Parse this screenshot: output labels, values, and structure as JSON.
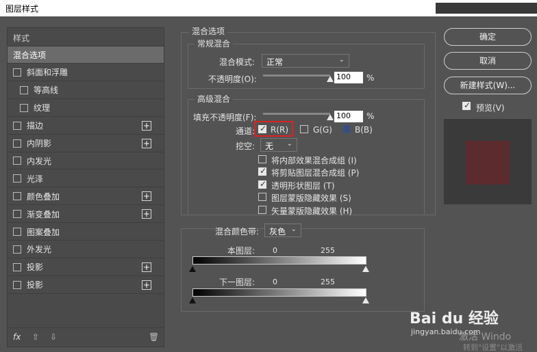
{
  "window": {
    "title": "图层样式"
  },
  "left": {
    "header": "样式",
    "items": [
      {
        "label": "混合选项",
        "checkbox": false,
        "plus": false,
        "selected": true,
        "indent": 0
      },
      {
        "label": "斜面和浮雕",
        "checkbox": true,
        "plus": false,
        "indent": 0
      },
      {
        "label": "等高线",
        "checkbox": true,
        "plus": false,
        "indent": 1
      },
      {
        "label": "纹理",
        "checkbox": true,
        "plus": false,
        "indent": 1
      },
      {
        "label": "描边",
        "checkbox": true,
        "plus": true,
        "indent": 0
      },
      {
        "label": "内阴影",
        "checkbox": true,
        "plus": true,
        "indent": 0
      },
      {
        "label": "内发光",
        "checkbox": true,
        "plus": false,
        "indent": 0
      },
      {
        "label": "光泽",
        "checkbox": true,
        "plus": false,
        "indent": 0
      },
      {
        "label": "颜色叠加",
        "checkbox": true,
        "plus": true,
        "indent": 0
      },
      {
        "label": "渐变叠加",
        "checkbox": true,
        "plus": true,
        "indent": 0
      },
      {
        "label": "图案叠加",
        "checkbox": true,
        "plus": false,
        "indent": 0
      },
      {
        "label": "外发光",
        "checkbox": true,
        "plus": false,
        "indent": 0
      },
      {
        "label": "投影",
        "checkbox": true,
        "plus": true,
        "indent": 0
      },
      {
        "label": "投影",
        "checkbox": true,
        "plus": true,
        "indent": 0
      }
    ],
    "bottom": {
      "fx": "fx",
      "plus": "+"
    }
  },
  "blend": {
    "section_title": "混合选项",
    "general": {
      "title": "常规混合",
      "mode_label": "混合模式:",
      "mode_value": "正常",
      "opacity_label": "不透明度(O):",
      "opacity_value": "100",
      "opacity_fraction": 1.0,
      "pct": "%"
    },
    "advanced": {
      "title": "高级混合",
      "fill_label": "填充不透明度(F):",
      "fill_value": "100",
      "fill_fraction": 1.0,
      "pct": "%",
      "channels_label": "通道:",
      "ch_r": "R(R)",
      "ch_g": "G(G)",
      "ch_b": "B(B)",
      "knockout_label": "挖空:",
      "knockout_value": "无",
      "options": [
        {
          "label": "将内部效果混合成组 (I)",
          "checked": false
        },
        {
          "label": "将剪贴图层混合成组 (P)",
          "checked": true
        },
        {
          "label": "透明形状图层 (T)",
          "checked": true
        },
        {
          "label": "图层蒙版隐藏效果 (S)",
          "checked": false
        },
        {
          "label": "矢量蒙版隐藏效果 (H)",
          "checked": false
        }
      ]
    },
    "blendif": {
      "label": "混合颜色带:",
      "value": "灰色",
      "this_layer": "本图层:",
      "underlying": "下一图层:",
      "min": "0",
      "max": "255"
    }
  },
  "buttons": {
    "ok": "确定",
    "cancel": "取消",
    "new_style": "新建样式(W)...",
    "preview": "预览(V)"
  },
  "watermark": {
    "logo": "Bai du 经验",
    "url": "jingyan.baidu.com",
    "activate": "激活 Windo",
    "goto": "转到\"设置\"以激活"
  },
  "colors": {
    "preview_swatch": "#5c2b2d",
    "highlight": "#e02020",
    "blue_channel": "#3b4e78"
  }
}
